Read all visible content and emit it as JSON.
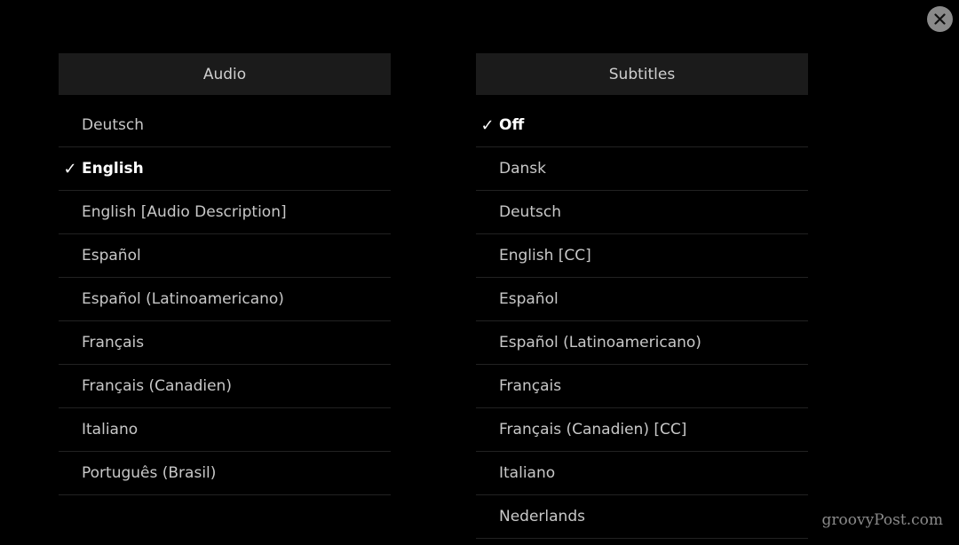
{
  "close_icon": "close-icon",
  "audio": {
    "title": "Audio",
    "items": [
      {
        "label": "Deutsch",
        "selected": false
      },
      {
        "label": "English",
        "selected": true
      },
      {
        "label": "English [Audio Description]",
        "selected": false
      },
      {
        "label": "Español",
        "selected": false
      },
      {
        "label": "Español (Latinoamericano)",
        "selected": false
      },
      {
        "label": "Français",
        "selected": false
      },
      {
        "label": "Français (Canadien)",
        "selected": false
      },
      {
        "label": "Italiano",
        "selected": false
      },
      {
        "label": "Português (Brasil)",
        "selected": false
      }
    ]
  },
  "subtitles": {
    "title": "Subtitles",
    "items": [
      {
        "label": "Off",
        "selected": true
      },
      {
        "label": "Dansk",
        "selected": false
      },
      {
        "label": "Deutsch",
        "selected": false
      },
      {
        "label": "English [CC]",
        "selected": false
      },
      {
        "label": "Español",
        "selected": false
      },
      {
        "label": "Español (Latinoamericano)",
        "selected": false
      },
      {
        "label": "Français",
        "selected": false
      },
      {
        "label": "Français (Canadien) [CC]",
        "selected": false
      },
      {
        "label": "Italiano",
        "selected": false
      },
      {
        "label": "Nederlands",
        "selected": false
      }
    ]
  },
  "check_glyph": "✓",
  "watermark": "groovyPost.com"
}
